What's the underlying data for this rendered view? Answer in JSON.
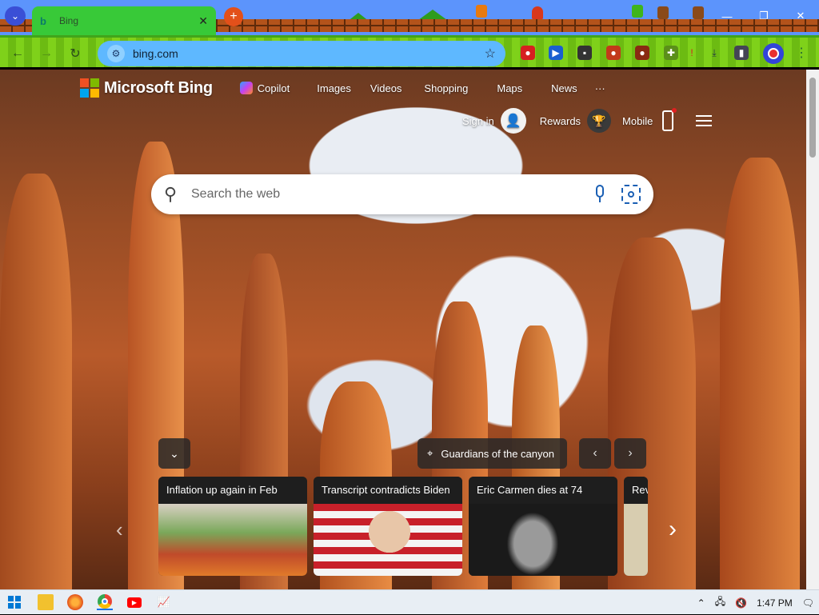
{
  "browser": {
    "tab_title": "Bing",
    "tab_close": "✕",
    "new_tab": "+",
    "url": "bing.com",
    "window_controls": {
      "minimize": "—",
      "restore": "❐",
      "close": "✕"
    }
  },
  "bing": {
    "logo_text": "Microsoft Bing",
    "nav": {
      "copilot": "Copilot",
      "images": "Images",
      "videos": "Videos",
      "shopping": "Shopping",
      "maps": "Maps",
      "news": "News",
      "more": "···"
    },
    "account": {
      "sign_in": "Sign in",
      "rewards": "Rewards",
      "mobile": "Mobile"
    },
    "search": {
      "placeholder": "Search the web"
    },
    "image_info": {
      "title": "Guardians of the canyon"
    },
    "news": [
      {
        "headline": "Inflation up again in Feb"
      },
      {
        "headline": "Transcript contradicts Biden"
      },
      {
        "headline": "Eric Carmen dies at 74"
      },
      {
        "headline": "Rev"
      }
    ]
  },
  "taskbar": {
    "time": "1:47 PM"
  },
  "colors": {
    "tab_active": "#38c938",
    "omnibox": "#5eb8ff",
    "toolbar": "#7fd11a",
    "taskbar": "#e8eef4"
  }
}
